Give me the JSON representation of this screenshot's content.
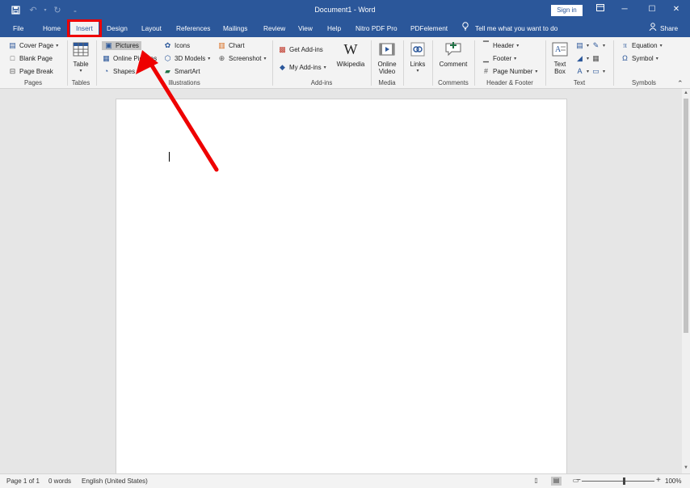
{
  "titlebar": {
    "title": "Document1  -  Word",
    "signin_label": "Sign in",
    "qat": {
      "save_icon": "save-icon",
      "undo_icon": "undo-icon",
      "redo_icon": "redo-icon",
      "customize_icon": "customize-qat-icon"
    }
  },
  "tabs": [
    {
      "label": "File"
    },
    {
      "label": "Home"
    },
    {
      "label": "Insert"
    },
    {
      "label": "Design"
    },
    {
      "label": "Layout"
    },
    {
      "label": "References"
    },
    {
      "label": "Mailings"
    },
    {
      "label": "Review"
    },
    {
      "label": "View"
    },
    {
      "label": "Help"
    },
    {
      "label": "Nitro PDF Pro"
    },
    {
      "label": "PDFelement"
    }
  ],
  "active_tab": "Insert",
  "tellme": {
    "label": "Tell me what you want to do"
  },
  "share": {
    "label": "Share"
  },
  "ribbon": {
    "pages": {
      "label": "Pages",
      "cover_page": "Cover Page",
      "blank_page": "Blank Page",
      "page_break": "Page Break"
    },
    "tables": {
      "label": "Tables",
      "table": "Table"
    },
    "illustrations": {
      "label": "Illustrations",
      "pictures": "Pictures",
      "online_pictures": "Online Pictures",
      "shapes": "Shapes",
      "icons": "Icons",
      "models_3d": "3D Models",
      "smartart": "SmartArt",
      "chart": "Chart",
      "screenshot": "Screenshot"
    },
    "addins": {
      "label": "Add-ins",
      "get_addins": "Get Add-ins",
      "my_addins": "My Add-ins",
      "wikipedia": "Wikipedia"
    },
    "media": {
      "label": "Media",
      "online_video_1": "Online",
      "online_video_2": "Video"
    },
    "links": {
      "label": "",
      "links": "Links"
    },
    "comments": {
      "label": "Comments",
      "comment": "Comment"
    },
    "header_footer": {
      "label": "Header & Footer",
      "header": "Header",
      "footer": "Footer",
      "page_number": "Page Number"
    },
    "text": {
      "label": "Text",
      "text_box_1": "Text",
      "text_box_2": "Box"
    },
    "symbols": {
      "label": "Symbols",
      "equation": "Equation",
      "symbol": "Symbol"
    }
  },
  "statusbar": {
    "page": "Page 1 of 1",
    "words": "0 words",
    "language": "English (United States)",
    "zoom": "100%"
  },
  "colors": {
    "accent": "#2b579a",
    "highlight": "#e00000"
  }
}
